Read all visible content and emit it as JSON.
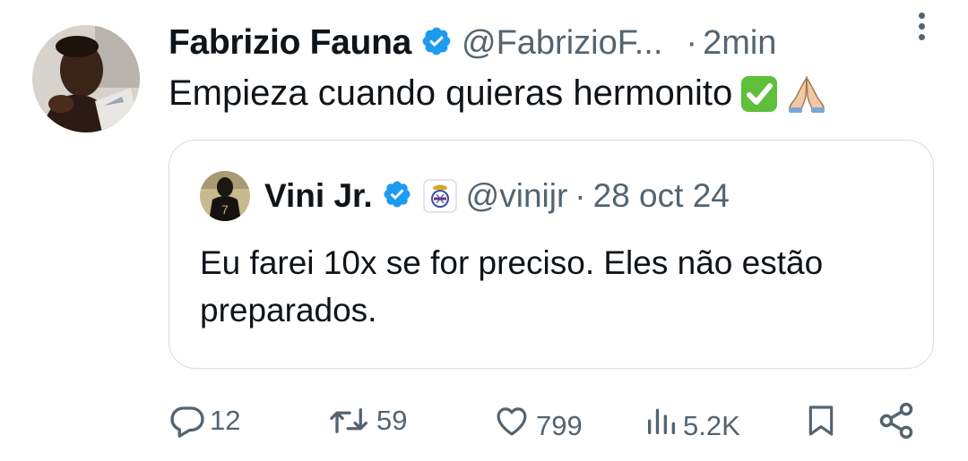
{
  "tweet": {
    "author": {
      "name": "Fabrizio Fauna",
      "handle": "@FabrizioF...",
      "verified": true
    },
    "dot": "·",
    "time": "2min",
    "text": "Empieza cuando quieras hermonito",
    "emojis": [
      "check-mark-button-icon",
      "folded-hands-icon"
    ]
  },
  "quote": {
    "author": {
      "name": "Vini Jr.",
      "handle": "@vinijr",
      "verified": true,
      "affiliation_badge": "real-madrid-crest-icon"
    },
    "dot": "·",
    "date": "28 oct 24",
    "text": "Eu farei 10x se for preciso. Eles não estão preparados."
  },
  "actions": {
    "replies": "12",
    "reposts": "59",
    "likes": "799",
    "views": "5.2K"
  },
  "colors": {
    "verified": "#1d9bf0",
    "secondary_text": "#536471",
    "border": "#d6dde2",
    "check_green": "#5fbf3a"
  }
}
